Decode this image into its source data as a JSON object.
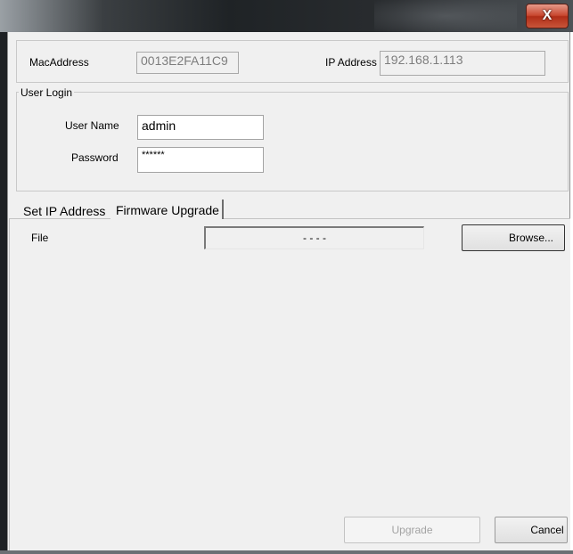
{
  "window": {
    "close_glyph": "X"
  },
  "device": {
    "mac_label": "MacAddress",
    "mac_value": "0013E2FA11C9",
    "ip_label": "IP Address",
    "ip_value": "192.168.1.113"
  },
  "login": {
    "group_label": "User Login",
    "username_label": "User Name",
    "username_value": "admin",
    "password_label": "Password",
    "password_value": "******"
  },
  "tabs": [
    {
      "label": "Set IP Address",
      "active": false
    },
    {
      "label": "Firmware Upgrade",
      "active": true
    }
  ],
  "firmware": {
    "file_label": "File",
    "file_value": "- - - -",
    "browse_label": "Browse...",
    "upgrade_label": "Upgrade",
    "upgrade_enabled": false,
    "cancel_label": "Cancel"
  }
}
